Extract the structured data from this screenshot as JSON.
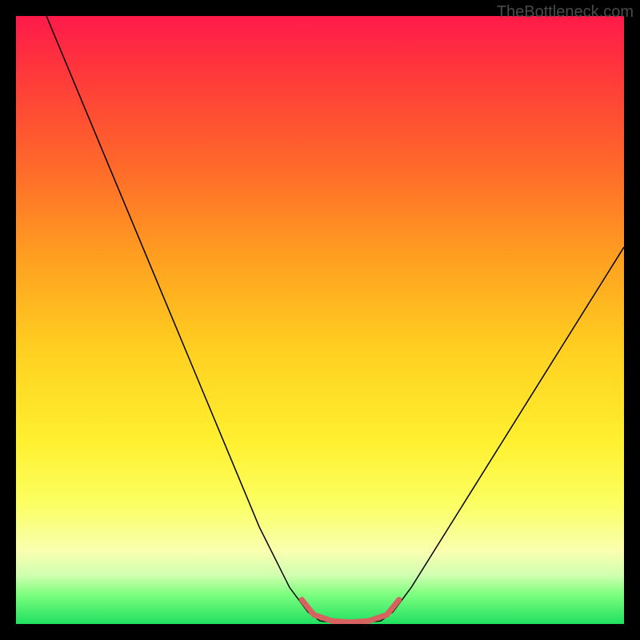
{
  "watermark": "TheBottleneck.com",
  "chart_data": {
    "type": "line",
    "title": "",
    "xlabel": "",
    "ylabel": "",
    "xlim": [
      0,
      100
    ],
    "ylim": [
      0,
      100
    ],
    "curves": [
      {
        "name": "bottleneck-curve",
        "color": "#000000",
        "width": 1.5,
        "points": [
          {
            "x": 5,
            "y": 100
          },
          {
            "x": 10,
            "y": 88
          },
          {
            "x": 15,
            "y": 76
          },
          {
            "x": 20,
            "y": 64
          },
          {
            "x": 25,
            "y": 52
          },
          {
            "x": 30,
            "y": 40
          },
          {
            "x": 35,
            "y": 28
          },
          {
            "x": 40,
            "y": 16
          },
          {
            "x": 45,
            "y": 6
          },
          {
            "x": 48,
            "y": 2
          },
          {
            "x": 50,
            "y": 0.5
          },
          {
            "x": 55,
            "y": 0
          },
          {
            "x": 60,
            "y": 0.5
          },
          {
            "x": 62,
            "y": 2
          },
          {
            "x": 65,
            "y": 6
          },
          {
            "x": 70,
            "y": 14
          },
          {
            "x": 75,
            "y": 22
          },
          {
            "x": 80,
            "y": 30
          },
          {
            "x": 85,
            "y": 38
          },
          {
            "x": 90,
            "y": 46
          },
          {
            "x": 95,
            "y": 54
          },
          {
            "x": 100,
            "y": 62
          }
        ]
      }
    ],
    "highlight_segment": {
      "name": "bottom-valley",
      "color": "#d6635f",
      "width": 7,
      "points": [
        {
          "x": 47,
          "y": 4
        },
        {
          "x": 49,
          "y": 1.5
        },
        {
          "x": 52,
          "y": 0.5
        },
        {
          "x": 55,
          "y": 0.3
        },
        {
          "x": 58,
          "y": 0.5
        },
        {
          "x": 61,
          "y": 1.5
        },
        {
          "x": 63,
          "y": 4
        }
      ]
    },
    "gradient_stops": [
      {
        "pos": 0,
        "color": "#ff1a4a"
      },
      {
        "pos": 10,
        "color": "#ff3a3a"
      },
      {
        "pos": 25,
        "color": "#ff6a2a"
      },
      {
        "pos": 40,
        "color": "#ffa020"
      },
      {
        "pos": 55,
        "color": "#ffd020"
      },
      {
        "pos": 70,
        "color": "#fff030"
      },
      {
        "pos": 80,
        "color": "#fbff60"
      },
      {
        "pos": 88,
        "color": "#faffb0"
      },
      {
        "pos": 92,
        "color": "#d0ffb0"
      },
      {
        "pos": 95,
        "color": "#80ff80"
      },
      {
        "pos": 100,
        "color": "#20e060"
      }
    ]
  }
}
